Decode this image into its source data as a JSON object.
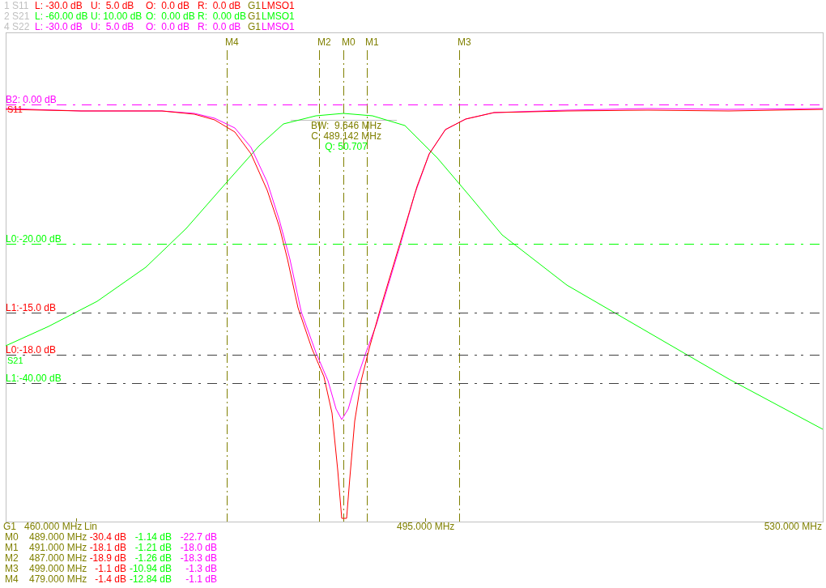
{
  "channels": [
    {
      "name": "1 S11",
      "color": "#ff0000",
      "lower": "L: -30.0 dB",
      "upper": "U:  5.0 dB",
      "offset": "O:  0.0 dB",
      "reference": "R:  0.0 dB",
      "group": "G1",
      "source": "LMSO1"
    },
    {
      "name": "2 S21",
      "color": "#00ff00",
      "lower": "L: -60.00 dB",
      "upper": "U: 10.00 dB",
      "offset": "O:  0.00 dB",
      "reference": "R:  0.00 dB",
      "group": "G1",
      "source": "LMSO1"
    },
    {
      "name": "4 S22",
      "color": "#ff00ff",
      "lower": "L: -30.0 dB",
      "upper": "U:  5.0 dB",
      "offset": "O:  0.0 dB",
      "reference": "R:  0.0 dB",
      "group": "G1",
      "source": "LMSO1"
    }
  ],
  "plot": {
    "markers": [
      {
        "label": "M4"
      },
      {
        "label": "M2"
      },
      {
        "label": "M0"
      },
      {
        "label": "M1"
      },
      {
        "label": "M3"
      }
    ],
    "limit_lines": [
      {
        "label": "B2: 0.00 dB",
        "color": "#ff00ff",
        "line": {
          "color": "#ff00ff"
        }
      },
      {
        "label": "L0:-20.00 dB",
        "color": "#00ff00",
        "line": {
          "color": "#00ff00"
        }
      },
      {
        "label": "L1:-15.0 dB",
        "color": "#ff0000",
        "line": {
          "color": "#404040"
        }
      },
      {
        "label": "L0:-18.0 dB",
        "color": "#ff0000",
        "line": {
          "color": "#404040"
        }
      },
      {
        "label": "L1:-40.00 dB",
        "color": "#00ff00",
        "line": {
          "color": "#404040"
        }
      }
    ],
    "trace_labels": [
      {
        "label": "S11",
        "color": "#ff0000"
      },
      {
        "label": "S21",
        "color": "#00ff00"
      }
    ],
    "bandwidth": {
      "bw": "BW:  9.646 MHz",
      "center": "C: 489.142 MHz",
      "q": "Q: 50.707"
    }
  },
  "axis": {
    "group": "G1",
    "start": "460.000 MHz",
    "scale": "Lin",
    "center": "495.000 MHz",
    "stop": "530.000 MHz"
  },
  "marker_table": [
    {
      "label": "M0",
      "frequency": "489.000 MHz",
      "values": [
        "-30.4 dB",
        "-1.14 dB",
        "-22.7 dB"
      ]
    },
    {
      "label": "M1",
      "frequency": "491.000 MHz",
      "values": [
        "-18.1 dB",
        "-1.21 dB",
        "-18.0 dB"
      ]
    },
    {
      "label": "M2",
      "frequency": "487.000 MHz",
      "values": [
        "-18.9 dB",
        "-1.26 dB",
        "-18.3 dB"
      ]
    },
    {
      "label": "M3",
      "frequency": "499.000 MHz",
      "values": [
        "-1.1 dB",
        "-10.94 dB",
        "-1.3 dB"
      ]
    },
    {
      "label": "M4",
      "frequency": "479.000 MHz",
      "values": [
        "-1.4 dB",
        "-12.84 dB",
        "-1.1 dB"
      ]
    }
  ]
}
